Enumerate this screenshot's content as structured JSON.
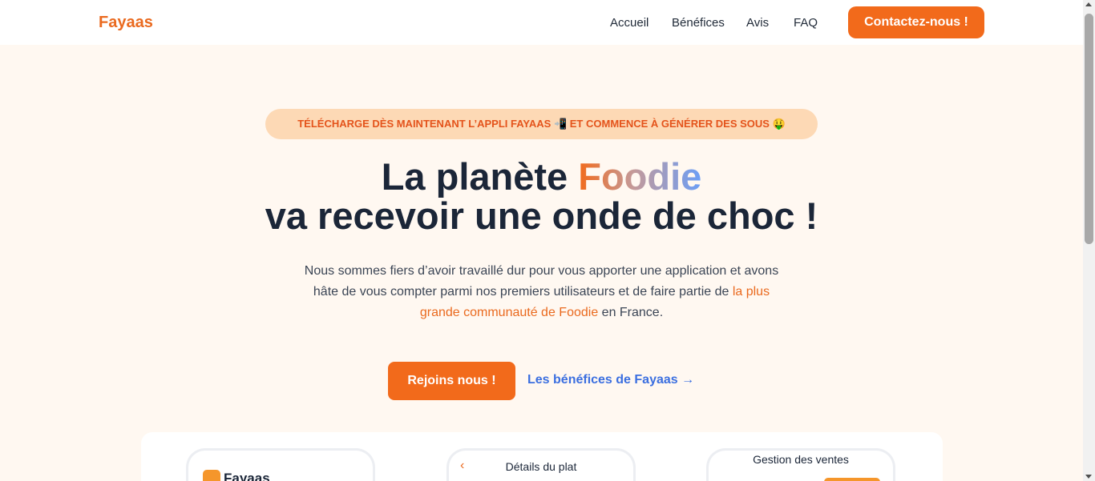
{
  "navbar": {
    "logo": "Fayaas",
    "links": [
      "Accueil",
      "Bénéfices",
      "Avis",
      "FAQ"
    ],
    "contact_label": "Contactez-nous !"
  },
  "hero": {
    "banner": "TÉLÉCHARGE DÈS MAINTENANT L’APPLI FAYAAS 📲 ET COMMENCE À GÉNÉRER DES SOUS 🤑",
    "title_prefix": "La planète ",
    "title_highlight": "Foodie",
    "title_line2": "va recevoir une onde de choc !",
    "desc_part1": "Nous sommes fiers d’avoir travaillé dur pour vous apporter une application et avons hâte de vous compter parmi nos premiers utilisateurs et de faire partie de ",
    "desc_highlight": "la plus grande communauté de Foodie",
    "desc_part2": " en France.",
    "cta_label": "Rejoins nous !",
    "secondary_link": "Les bénéfices de Fayaas →"
  },
  "showcase": {
    "phone1_logo": "Fayaas",
    "phone2_back": "‹",
    "phone2_title": "Détails du plat",
    "phone3_title": "Gestion des ventes"
  },
  "colors": {
    "accent": "#f26a1b",
    "banner_bg": "#fdd9b5",
    "page_bg": "#fff8f1",
    "link_blue": "#3b6fe0",
    "title_dark": "#1b2638"
  }
}
